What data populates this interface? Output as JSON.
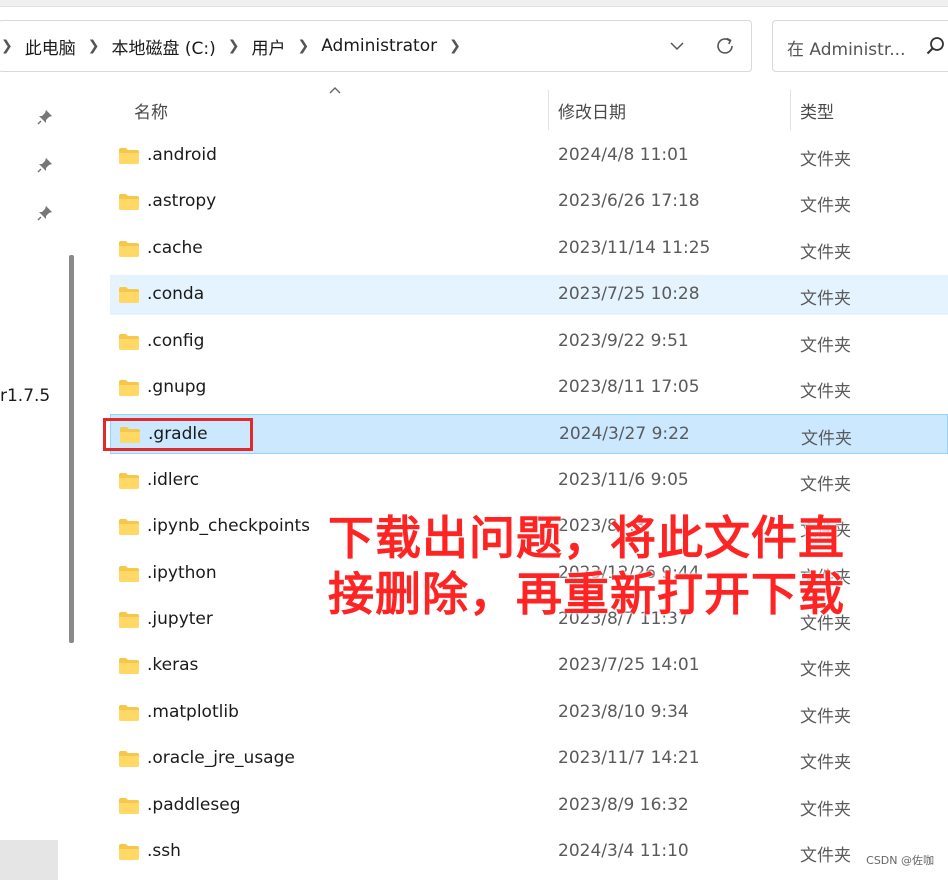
{
  "address_bar": {
    "crumbs": [
      "此电脑",
      "本地磁盘 (C:)",
      "用户",
      "Administrator"
    ],
    "dropdown_icon": "chevron-down-icon",
    "refresh_icon": "refresh-icon"
  },
  "search": {
    "placeholder": "在 Administr...",
    "icon": "search-icon"
  },
  "nav": {
    "visible_label": "r1.7.5",
    "pin_icon": "pin-icon"
  },
  "columns": {
    "name": "名称",
    "modified": "修改日期",
    "type": "类型"
  },
  "files": [
    {
      "name": ".android",
      "date": "2024/4/8 11:01",
      "type": "文件夹"
    },
    {
      "name": ".astropy",
      "date": "2023/6/26 17:18",
      "type": "文件夹"
    },
    {
      "name": ".cache",
      "date": "2023/11/14 11:25",
      "type": "文件夹"
    },
    {
      "name": ".conda",
      "date": "2023/7/25 10:28",
      "type": "文件夹",
      "state": "hover"
    },
    {
      "name": ".config",
      "date": "2023/9/22 9:51",
      "type": "文件夹"
    },
    {
      "name": ".gnupg",
      "date": "2023/8/11 17:05",
      "type": "文件夹"
    },
    {
      "name": ".gradle",
      "date": "2024/3/27 9:22",
      "type": "文件夹",
      "state": "selected"
    },
    {
      "name": ".idlerc",
      "date": "2023/11/6 9:05",
      "type": "文件夹"
    },
    {
      "name": ".ipynb_checkpoints",
      "date": "2023/8/ :3",
      "type": "文件夹"
    },
    {
      "name": ".ipython",
      "date": "2023/12/26 9:44",
      "type": "文件夹"
    },
    {
      "name": ".jupyter",
      "date": "2023/8/7 11:37",
      "type": "文件夹"
    },
    {
      "name": ".keras",
      "date": "2023/7/25 14:01",
      "type": "文件夹"
    },
    {
      "name": ".matplotlib",
      "date": "2023/8/10 9:34",
      "type": "文件夹"
    },
    {
      "name": ".oracle_jre_usage",
      "date": "2023/11/7 14:21",
      "type": "文件夹"
    },
    {
      "name": ".paddleseg",
      "date": "2023/8/9 16:32",
      "type": "文件夹"
    },
    {
      "name": ".ssh",
      "date": "2024/3/4 11:10",
      "type": "文件夹"
    }
  ],
  "annotation": {
    "line1": "下载出问题，将此文件直",
    "line2": "接删除，再重新打开下载",
    "color": "#ff2424"
  },
  "watermark": "CSDN @佐咖",
  "colors": {
    "hover_row": "#e5f3ff",
    "selected_row": "#cce8ff",
    "highlight_box": "#e12a2a",
    "folder": "#f5c84c"
  }
}
